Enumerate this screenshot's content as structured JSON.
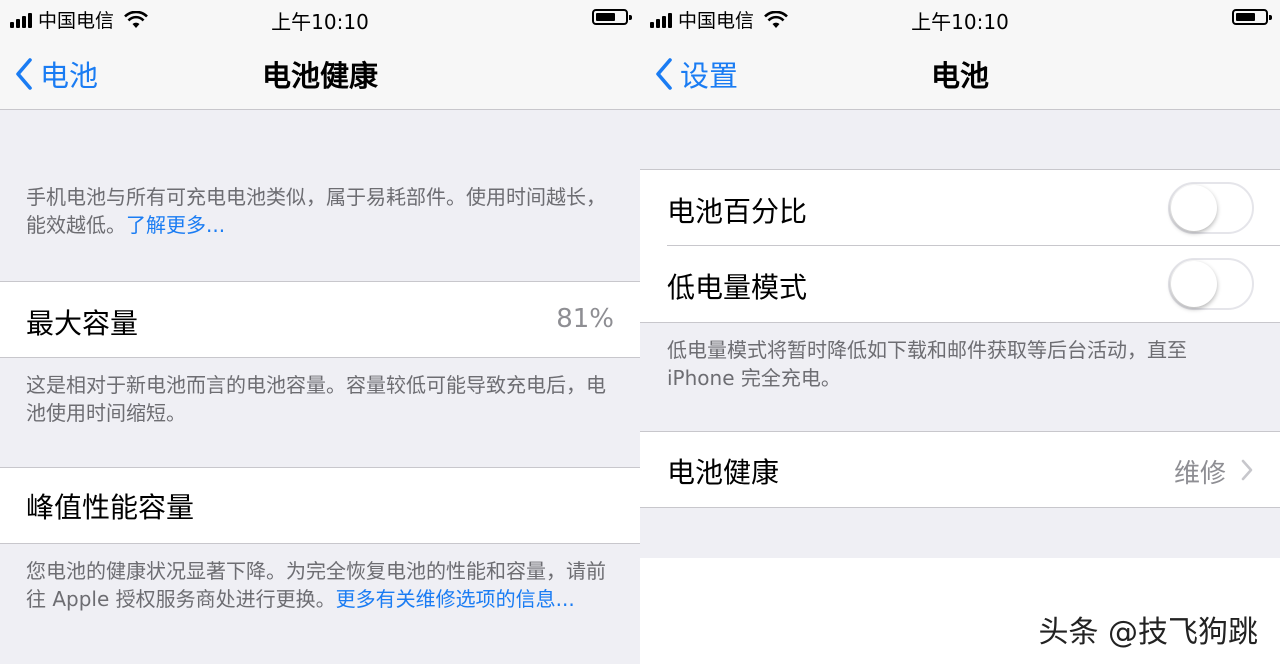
{
  "status_bar": {
    "carrier": "中国电信",
    "time": "上午10:10"
  },
  "left_screen": {
    "nav": {
      "back_label": "电池",
      "title": "电池健康"
    },
    "intro_text": "手机电池与所有可充电电池类似，属于易耗部件。使用时间越长，能效越低。",
    "intro_link": "了解更多...",
    "max_capacity": {
      "label": "最大容量",
      "value": "81%"
    },
    "max_capacity_note": "这是相对于新电池而言的电池容量。容量较低可能导致充电后，电池使用时间缩短。",
    "peak_performance": {
      "label": "峰值性能容量"
    },
    "peak_note": "您电池的健康状况显著下降。为完全恢复电池的性能和容量，请前往 Apple 授权服务商处进行更换。",
    "peak_link": "更多有关维修选项的信息..."
  },
  "right_screen": {
    "nav": {
      "back_label": "设置",
      "title": "电池"
    },
    "battery_percentage": {
      "label": "电池百分比",
      "on": false
    },
    "low_power_mode": {
      "label": "低电量模式",
      "on": false
    },
    "low_power_note": "低电量模式将暂时降低如下载和邮件获取等后台活动，直至 iPhone 完全充电。",
    "battery_health": {
      "label": "电池健康",
      "value": "维修"
    }
  },
  "watermark": "头条 @技飞狗跳",
  "colors": {
    "accent": "#1a7cf3",
    "secondary_text": "#6d6d72",
    "background": "#efeff4"
  }
}
